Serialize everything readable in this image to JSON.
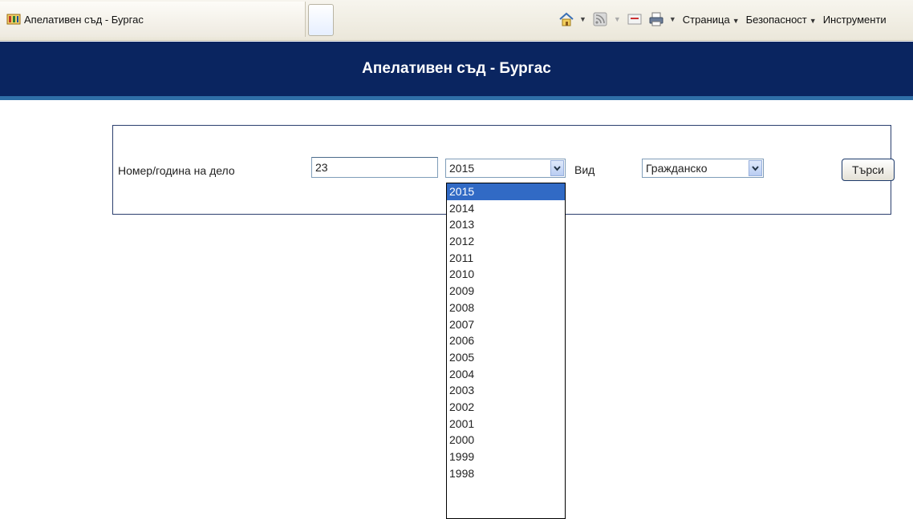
{
  "browser": {
    "tab_title": "Апелативен съд - Бургас",
    "commands": {
      "page": "Страница",
      "safety": "Безопасност",
      "tools": "Инструменти"
    },
    "icons": [
      "site-favicon",
      "home-icon",
      "rss-feed-icon",
      "read-mail-icon",
      "print-icon"
    ]
  },
  "header": {
    "title": "Апелативен съд - Бургас"
  },
  "search_form": {
    "case_label": "Номер/година на дело",
    "case_number_value": "23",
    "year_selected": "2015",
    "type_label": "Вид",
    "type_selected": "Гражданско",
    "search_button": "Търси"
  },
  "year_options": [
    "2015",
    "2014",
    "2013",
    "2012",
    "2011",
    "2010",
    "2009",
    "2008",
    "2007",
    "2006",
    "2005",
    "2004",
    "2003",
    "2002",
    "2001",
    "2000",
    "1999",
    "1998"
  ],
  "colors": {
    "header_bg": "#0a2560",
    "header_stripe": "#2f6fa8",
    "selected_option": "#316ac5"
  }
}
